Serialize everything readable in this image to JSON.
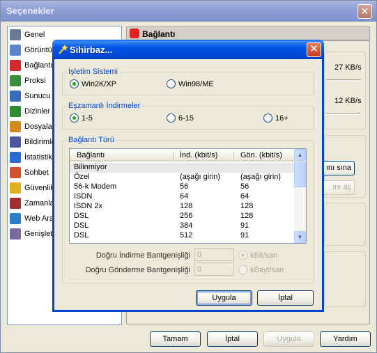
{
  "outer_window": {
    "title": "Seçenekler",
    "close_symbol": "✕",
    "nav_items": [
      {
        "label": "Genel",
        "icon": "gear-icon",
        "color": "#6b7a99"
      },
      {
        "label": "Görüntü",
        "icon": "monitor-icon",
        "color": "#5a86c9"
      },
      {
        "label": "Bağlantı",
        "icon": "plug-icon",
        "color": "#d12a2a"
      },
      {
        "label": "Proksi",
        "icon": "proxy-icon",
        "color": "#3b8f3b"
      },
      {
        "label": "Sunucu",
        "icon": "server-icon",
        "color": "#3a6dbb"
      },
      {
        "label": "Dizinler",
        "icon": "folder-tree-icon",
        "color": "#2e8b2e"
      },
      {
        "label": "Dosyalar",
        "icon": "files-icon",
        "color": "#d28a1e"
      },
      {
        "label": "Bildirimler",
        "icon": "notification-icon",
        "color": "#4a5a9a"
      },
      {
        "label": "İstatistik",
        "icon": "statistics-icon",
        "color": "#2a6bd1"
      },
      {
        "label": "Sohbet",
        "icon": "chat-icon",
        "color": "#d05030"
      },
      {
        "label": "Güvenlik",
        "icon": "lock-icon",
        "color": "#e0b020"
      },
      {
        "label": "Zamanla",
        "icon": "calendar-icon",
        "color": "#a03030"
      },
      {
        "label": "Web Ara",
        "icon": "globe-icon",
        "color": "#2a80c8"
      },
      {
        "label": "Genişlet",
        "icon": "extensions-icon",
        "color": "#7a6aa0"
      }
    ],
    "panel_title": "Bağlantı",
    "panel_peek": {
      "download_speed": "27 KB/s",
      "upload_speed": "12 KB/s",
      "test_button": "ını sına",
      "open_button": "ını aç"
    },
    "buttons": {
      "ok": "Tamam",
      "cancel": "İptal",
      "apply": "Uygula",
      "help": "Yardım"
    }
  },
  "wizard": {
    "title": "Sihirbaz...",
    "close_symbol": "✕",
    "os_group": {
      "title": "İşletim Sistemi",
      "options": [
        {
          "label": "Win2K/XP",
          "selected": true
        },
        {
          "label": "Win98/ME",
          "selected": false
        }
      ]
    },
    "downloads_group": {
      "title": "Eşzamanlı İndirmeler",
      "options": [
        {
          "label": "1-5",
          "selected": true
        },
        {
          "label": "6-15",
          "selected": false
        },
        {
          "label": "16+",
          "selected": false
        }
      ]
    },
    "conn_group": {
      "title": "Bağlantı Türü",
      "columns": [
        "Bağlantı",
        "İnd. (kbit/s)",
        "Gön. (kbit/s)"
      ],
      "rows": [
        {
          "name": "Bilinmiyor",
          "down": "",
          "up": ""
        },
        {
          "name": "Özel",
          "down": "(aşağı girin)",
          "up": "(aşağı girin)"
        },
        {
          "name": "56-k Modem",
          "down": "56",
          "up": "56"
        },
        {
          "name": "ISDN",
          "down": "64",
          "up": "64"
        },
        {
          "name": "ISDN 2x",
          "down": "128",
          "up": "128"
        },
        {
          "name": "DSL",
          "down": "256",
          "up": "128"
        },
        {
          "name": "DSL",
          "down": "384",
          "up": "91"
        },
        {
          "name": "DSL",
          "down": "512",
          "up": "91"
        }
      ],
      "selected_row": 0,
      "download_label": "Doğru İndirme Bantgenişliği",
      "upload_label": "Doğru Gönderme Bantgenişliği",
      "download_value": "0",
      "upload_value": "0",
      "unit_options": [
        {
          "label": "kBit/san",
          "selected": true
        },
        {
          "label": "kBayt/san",
          "selected": false
        }
      ]
    },
    "buttons": {
      "apply": "Uygula",
      "cancel": "İptal"
    }
  }
}
